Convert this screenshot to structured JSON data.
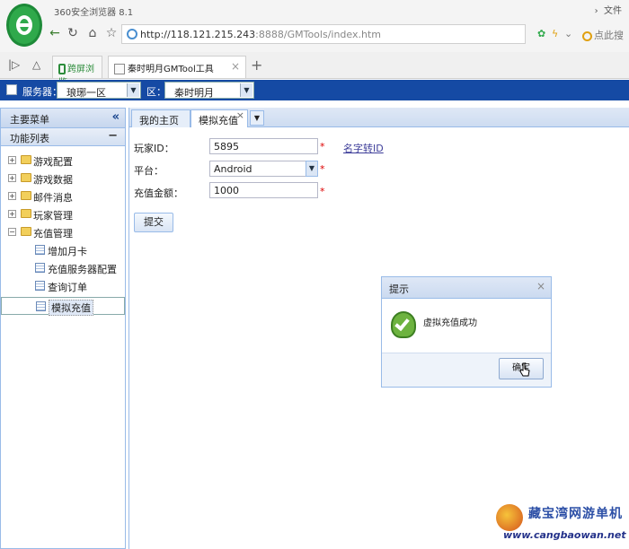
{
  "browser": {
    "app_title": "360安全浏览器 8.1",
    "top_right_label": "文件",
    "url_host": "http://118.121.215.243",
    "url_rest": ":8888/GMTools/index.htm",
    "search_placeholder": "点此搜",
    "tabs": [
      {
        "label": "跨屏浏览"
      },
      {
        "label": "秦时明月GMTool工具"
      }
    ]
  },
  "toolbar": {
    "server_label": "服务器：",
    "server_value": "琅琊一区",
    "zone_label": "区：",
    "zone_value": "秦时明月"
  },
  "sidebar": {
    "title": "主要菜单",
    "section": "功能列表",
    "items": [
      {
        "label": "游戏配置",
        "expander": "+"
      },
      {
        "label": "游戏数据",
        "expander": "+"
      },
      {
        "label": "邮件消息",
        "expander": "+"
      },
      {
        "label": "玩家管理",
        "expander": "+"
      },
      {
        "label": "充值管理",
        "expander": "−"
      }
    ],
    "children": [
      {
        "label": "增加月卡"
      },
      {
        "label": "充值服务器配置"
      },
      {
        "label": "查询订单"
      },
      {
        "label": "模拟充值"
      }
    ]
  },
  "main": {
    "tabs": [
      {
        "label": "我的主页"
      },
      {
        "label": "模拟充值"
      }
    ],
    "form": {
      "player_id_label": "玩家ID：",
      "player_id_value": "5895",
      "platform_label": "平台：",
      "platform_value": "Android",
      "amount_label": "充值金额：",
      "amount_value": "1000",
      "required_mark": "*",
      "name_to_id_link": "名字转ID",
      "submit_label": "提交"
    }
  },
  "dialog": {
    "title": "提示",
    "message": "虚拟充值成功",
    "ok_label": "确定"
  },
  "watermark": {
    "cn": "藏宝湾网游单机",
    "en": "www.cangbaowan.net"
  }
}
